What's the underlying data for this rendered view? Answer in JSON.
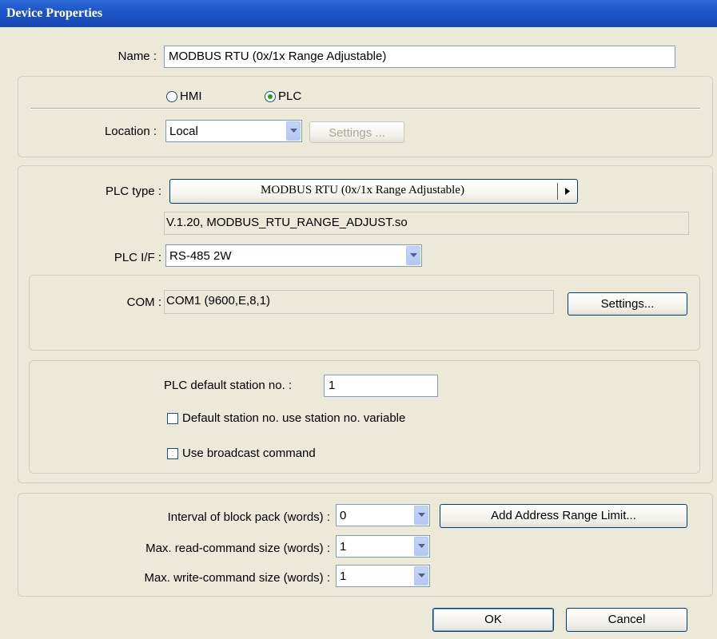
{
  "window": {
    "title": "Device Properties"
  },
  "name": {
    "label": "Name :",
    "value": "MODBUS RTU (0x/1x Range Adjustable)"
  },
  "target": {
    "options": [
      {
        "label": "HMI",
        "selected": false
      },
      {
        "label": "PLC",
        "selected": true
      }
    ]
  },
  "location": {
    "label": "Location :",
    "value": "Local",
    "settings_label": "Settings ..."
  },
  "plc": {
    "type_label": "PLC type :",
    "type_value": "MODBUS RTU (0x/1x Range Adjustable)",
    "version": "V.1.20, MODBUS_RTU_RANGE_ADJUST.so",
    "if_label": "PLC I/F :",
    "if_value": "RS-485 2W"
  },
  "com": {
    "label": "COM :",
    "value": "COM1 (9600,E,8,1)",
    "settings_label": "Settings..."
  },
  "station": {
    "label": "PLC default station no. :",
    "value": "1",
    "use_variable_label": "Default station no. use station no. variable",
    "use_variable_checked": false,
    "broadcast_label": "Use broadcast command",
    "broadcast_checked": false
  },
  "advanced": {
    "interval_label": "Interval of block pack (words) :",
    "interval_value": "0",
    "read_label": "Max. read-command size (words) :",
    "read_value": "1",
    "write_label": "Max. write-command size (words) :",
    "write_value": "1",
    "add_range_label": "Add Address Range Limit..."
  },
  "footer": {
    "ok_label": "OK",
    "cancel_label": "Cancel"
  },
  "colors": {
    "title_bar": "#1e56c8",
    "dialog_bg": "#ece9d8",
    "radio_selected": "#21a121"
  }
}
